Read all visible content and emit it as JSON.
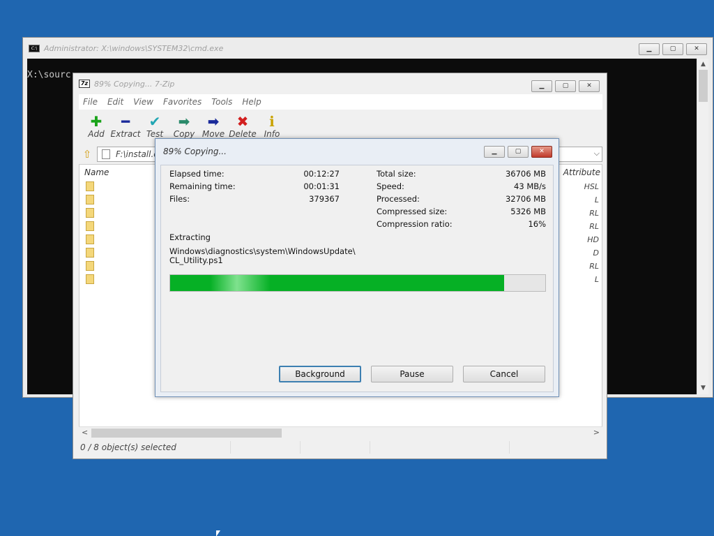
{
  "cmd": {
    "title": "Administrator: X:\\windows\\SYSTEM32\\cmd.exe",
    "prompt": "X:\\sourc"
  },
  "zip": {
    "title": "89% Copying... 7-Zip",
    "menu": [
      "File",
      "Edit",
      "View",
      "Favorites",
      "Tools",
      "Help"
    ],
    "toolbar": [
      {
        "label": "Add",
        "icon": "plus-icon",
        "glyph": "✚",
        "color": "#1aa31a"
      },
      {
        "label": "Extract",
        "icon": "minus-icon",
        "glyph": "━",
        "color": "#1a2a9a"
      },
      {
        "label": "Test",
        "icon": "check-icon",
        "glyph": "✔",
        "color": "#22a6b3"
      },
      {
        "label": "Copy",
        "icon": "copy-arrow-icon",
        "glyph": "➡",
        "color": "#2a8a6a"
      },
      {
        "label": "Move",
        "icon": "move-arrow-icon",
        "glyph": "➡",
        "color": "#1a2a9a"
      },
      {
        "label": "Delete",
        "icon": "delete-x-icon",
        "glyph": "✖",
        "color": "#d21f1f"
      },
      {
        "label": "Info",
        "icon": "info-icon",
        "glyph": "ℹ",
        "color": "#c9a200"
      }
    ],
    "address": "F:\\install.e",
    "list": {
      "col_name": "Name",
      "col_attr": "Attribute",
      "attributes": [
        "HSL",
        "L",
        "RL",
        "RL",
        "HD",
        "D",
        "RL",
        "L"
      ]
    },
    "status": {
      "selected": "0 / 8 object(s) selected"
    }
  },
  "progress": {
    "title": "89% Copying...",
    "left_stats": [
      {
        "label": "Elapsed time:",
        "value": "00:12:27"
      },
      {
        "label": "Remaining time:",
        "value": "00:01:31"
      },
      {
        "label": "Files:",
        "value": "379367"
      }
    ],
    "right_stats": [
      {
        "label": "Total size:",
        "value": "36706 MB"
      },
      {
        "label": "Speed:",
        "value": "43 MB/s"
      },
      {
        "label": "Processed:",
        "value": "32706 MB"
      },
      {
        "label": "Compressed size:",
        "value": "5326 MB"
      },
      {
        "label": "Compression ratio:",
        "value": "16%"
      }
    ],
    "operation": "Extracting",
    "current_path_line1": "Windows\\diagnostics\\system\\WindowsUpdate\\",
    "current_path_line2": "CL_Utility.ps1",
    "percent": 0.89,
    "buttons": {
      "background": "Background",
      "pause": "Pause",
      "cancel": "Cancel"
    }
  }
}
